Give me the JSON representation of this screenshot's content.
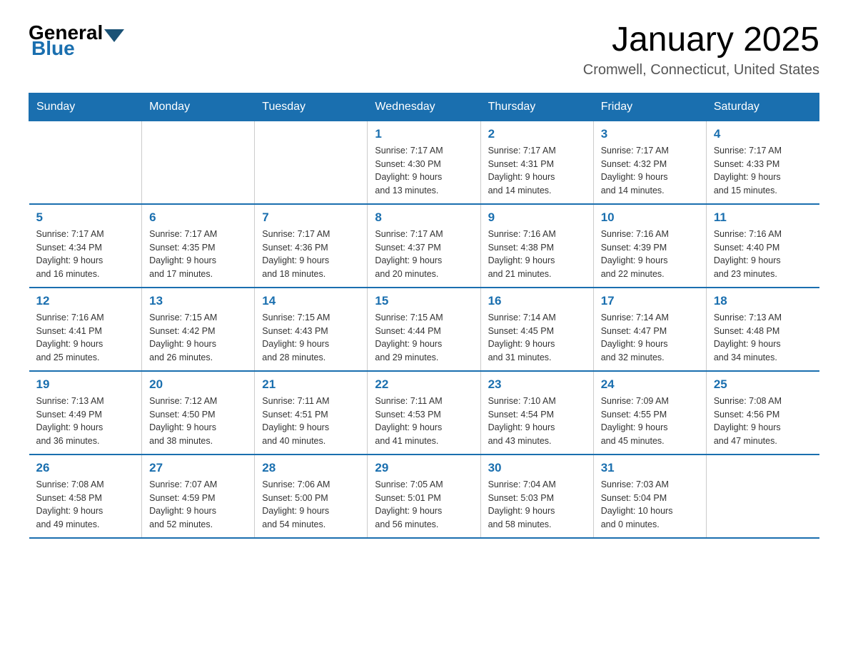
{
  "header": {
    "title": "January 2025",
    "subtitle": "Cromwell, Connecticut, United States"
  },
  "logo": {
    "general": "General",
    "blue": "Blue"
  },
  "days_of_week": [
    "Sunday",
    "Monday",
    "Tuesday",
    "Wednesday",
    "Thursday",
    "Friday",
    "Saturday"
  ],
  "weeks": [
    [
      {
        "day": "",
        "info": ""
      },
      {
        "day": "",
        "info": ""
      },
      {
        "day": "",
        "info": ""
      },
      {
        "day": "1",
        "info": "Sunrise: 7:17 AM\nSunset: 4:30 PM\nDaylight: 9 hours\nand 13 minutes."
      },
      {
        "day": "2",
        "info": "Sunrise: 7:17 AM\nSunset: 4:31 PM\nDaylight: 9 hours\nand 14 minutes."
      },
      {
        "day": "3",
        "info": "Sunrise: 7:17 AM\nSunset: 4:32 PM\nDaylight: 9 hours\nand 14 minutes."
      },
      {
        "day": "4",
        "info": "Sunrise: 7:17 AM\nSunset: 4:33 PM\nDaylight: 9 hours\nand 15 minutes."
      }
    ],
    [
      {
        "day": "5",
        "info": "Sunrise: 7:17 AM\nSunset: 4:34 PM\nDaylight: 9 hours\nand 16 minutes."
      },
      {
        "day": "6",
        "info": "Sunrise: 7:17 AM\nSunset: 4:35 PM\nDaylight: 9 hours\nand 17 minutes."
      },
      {
        "day": "7",
        "info": "Sunrise: 7:17 AM\nSunset: 4:36 PM\nDaylight: 9 hours\nand 18 minutes."
      },
      {
        "day": "8",
        "info": "Sunrise: 7:17 AM\nSunset: 4:37 PM\nDaylight: 9 hours\nand 20 minutes."
      },
      {
        "day": "9",
        "info": "Sunrise: 7:16 AM\nSunset: 4:38 PM\nDaylight: 9 hours\nand 21 minutes."
      },
      {
        "day": "10",
        "info": "Sunrise: 7:16 AM\nSunset: 4:39 PM\nDaylight: 9 hours\nand 22 minutes."
      },
      {
        "day": "11",
        "info": "Sunrise: 7:16 AM\nSunset: 4:40 PM\nDaylight: 9 hours\nand 23 minutes."
      }
    ],
    [
      {
        "day": "12",
        "info": "Sunrise: 7:16 AM\nSunset: 4:41 PM\nDaylight: 9 hours\nand 25 minutes."
      },
      {
        "day": "13",
        "info": "Sunrise: 7:15 AM\nSunset: 4:42 PM\nDaylight: 9 hours\nand 26 minutes."
      },
      {
        "day": "14",
        "info": "Sunrise: 7:15 AM\nSunset: 4:43 PM\nDaylight: 9 hours\nand 28 minutes."
      },
      {
        "day": "15",
        "info": "Sunrise: 7:15 AM\nSunset: 4:44 PM\nDaylight: 9 hours\nand 29 minutes."
      },
      {
        "day": "16",
        "info": "Sunrise: 7:14 AM\nSunset: 4:45 PM\nDaylight: 9 hours\nand 31 minutes."
      },
      {
        "day": "17",
        "info": "Sunrise: 7:14 AM\nSunset: 4:47 PM\nDaylight: 9 hours\nand 32 minutes."
      },
      {
        "day": "18",
        "info": "Sunrise: 7:13 AM\nSunset: 4:48 PM\nDaylight: 9 hours\nand 34 minutes."
      }
    ],
    [
      {
        "day": "19",
        "info": "Sunrise: 7:13 AM\nSunset: 4:49 PM\nDaylight: 9 hours\nand 36 minutes."
      },
      {
        "day": "20",
        "info": "Sunrise: 7:12 AM\nSunset: 4:50 PM\nDaylight: 9 hours\nand 38 minutes."
      },
      {
        "day": "21",
        "info": "Sunrise: 7:11 AM\nSunset: 4:51 PM\nDaylight: 9 hours\nand 40 minutes."
      },
      {
        "day": "22",
        "info": "Sunrise: 7:11 AM\nSunset: 4:53 PM\nDaylight: 9 hours\nand 41 minutes."
      },
      {
        "day": "23",
        "info": "Sunrise: 7:10 AM\nSunset: 4:54 PM\nDaylight: 9 hours\nand 43 minutes."
      },
      {
        "day": "24",
        "info": "Sunrise: 7:09 AM\nSunset: 4:55 PM\nDaylight: 9 hours\nand 45 minutes."
      },
      {
        "day": "25",
        "info": "Sunrise: 7:08 AM\nSunset: 4:56 PM\nDaylight: 9 hours\nand 47 minutes."
      }
    ],
    [
      {
        "day": "26",
        "info": "Sunrise: 7:08 AM\nSunset: 4:58 PM\nDaylight: 9 hours\nand 49 minutes."
      },
      {
        "day": "27",
        "info": "Sunrise: 7:07 AM\nSunset: 4:59 PM\nDaylight: 9 hours\nand 52 minutes."
      },
      {
        "day": "28",
        "info": "Sunrise: 7:06 AM\nSunset: 5:00 PM\nDaylight: 9 hours\nand 54 minutes."
      },
      {
        "day": "29",
        "info": "Sunrise: 7:05 AM\nSunset: 5:01 PM\nDaylight: 9 hours\nand 56 minutes."
      },
      {
        "day": "30",
        "info": "Sunrise: 7:04 AM\nSunset: 5:03 PM\nDaylight: 9 hours\nand 58 minutes."
      },
      {
        "day": "31",
        "info": "Sunrise: 7:03 AM\nSunset: 5:04 PM\nDaylight: 10 hours\nand 0 minutes."
      },
      {
        "day": "",
        "info": ""
      }
    ]
  ]
}
